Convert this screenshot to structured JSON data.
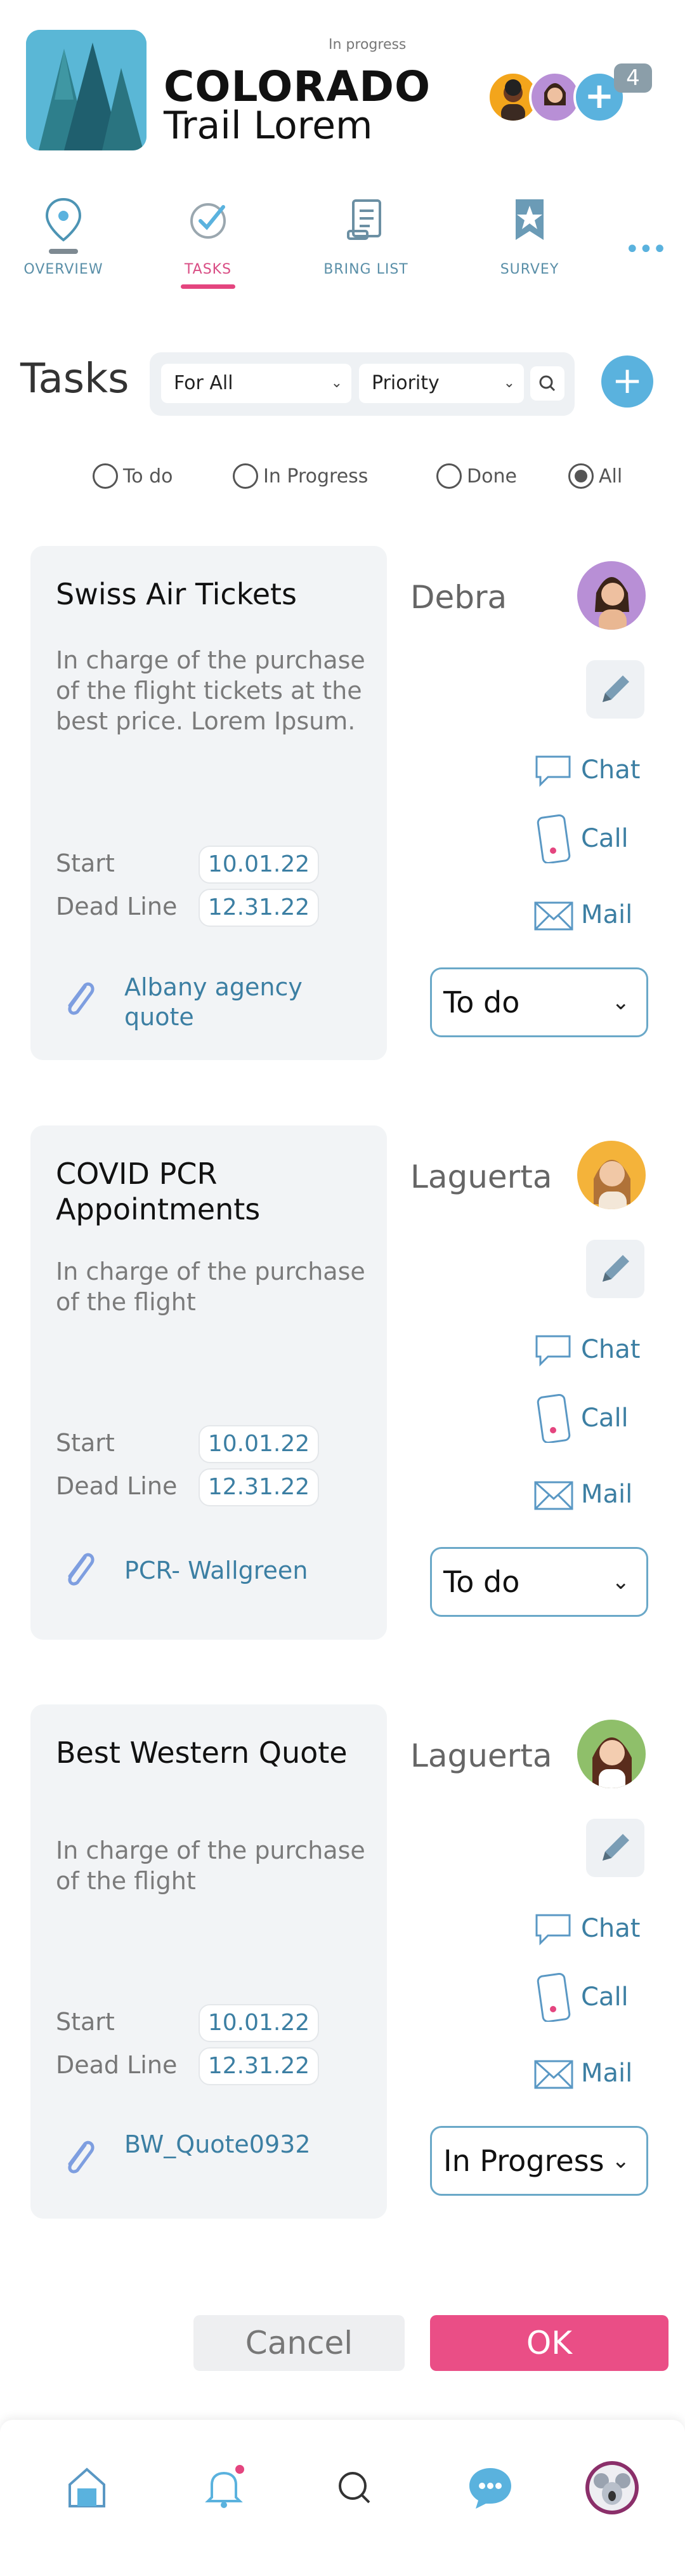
{
  "header": {
    "status": "In progress",
    "title_line1": "COLORADO",
    "title_line2": "Trail Lorem",
    "member_count": "4",
    "add_member_label": "+"
  },
  "tabs": [
    {
      "label": "OVERVIEW",
      "icon": "map-pin-icon"
    },
    {
      "label": "TASKS",
      "icon": "task-check-icon",
      "active": true
    },
    {
      "label": "BRING LIST",
      "icon": "list-document-icon"
    },
    {
      "label": "SURVEY",
      "icon": "star-bookmark-icon"
    }
  ],
  "more_label": "•••",
  "filters": {
    "heading": "Tasks",
    "assignee_select": "For All",
    "priority_select": "Priority",
    "add_task_label": "+"
  },
  "radios": [
    {
      "label": "To do",
      "checked": false
    },
    {
      "label": "In Progress",
      "checked": false
    },
    {
      "label": "Done",
      "checked": false
    },
    {
      "label": "All",
      "checked": true
    }
  ],
  "tasks": [
    {
      "title": "Swiss Air Tickets",
      "description": "In charge of the purchase of  the flight tickets at the best price. Lorem Ipsum.",
      "start_label": "Start",
      "start": "10.01.22",
      "deadline_label": "Dead Line",
      "deadline": "12.31.22",
      "attachment": "Albany agency quote",
      "assignee": "Debra",
      "chat_label": "Chat",
      "call_label": "Call",
      "mail_label": "Mail",
      "status": "To do"
    },
    {
      "title": "COVID PCR Appointments",
      "description": "In charge of the purchase of  the flight",
      "start_label": "Start",
      "start": "10.01.22",
      "deadline_label": "Dead Line",
      "deadline": "12.31.22",
      "attachment": "PCR- Wallgreen",
      "assignee": "Laguerta",
      "chat_label": "Chat",
      "call_label": "Call",
      "mail_label": "Mail",
      "status": "To do"
    },
    {
      "title": "Best Western Quote",
      "description": "In charge of the purchase of  the flight",
      "start_label": "Start",
      "start": "10.01.22",
      "deadline_label": "Dead Line",
      "deadline": "12.31.22",
      "attachment": "BW_Quote0932",
      "assignee": "Laguerta",
      "chat_label": "Chat",
      "call_label": "Call",
      "mail_label": "Mail",
      "status": "In Progress"
    }
  ],
  "actions": {
    "cancel": "Cancel",
    "ok": "OK"
  },
  "bottom_nav": [
    "home-icon",
    "bell-icon",
    "search-icon",
    "chat-bubble-icon",
    "profile-avatar"
  ],
  "colors": {
    "accent_blue": "#5ab2de",
    "accent_pink": "#ea4e86",
    "link_blue": "#3c7fa3"
  }
}
